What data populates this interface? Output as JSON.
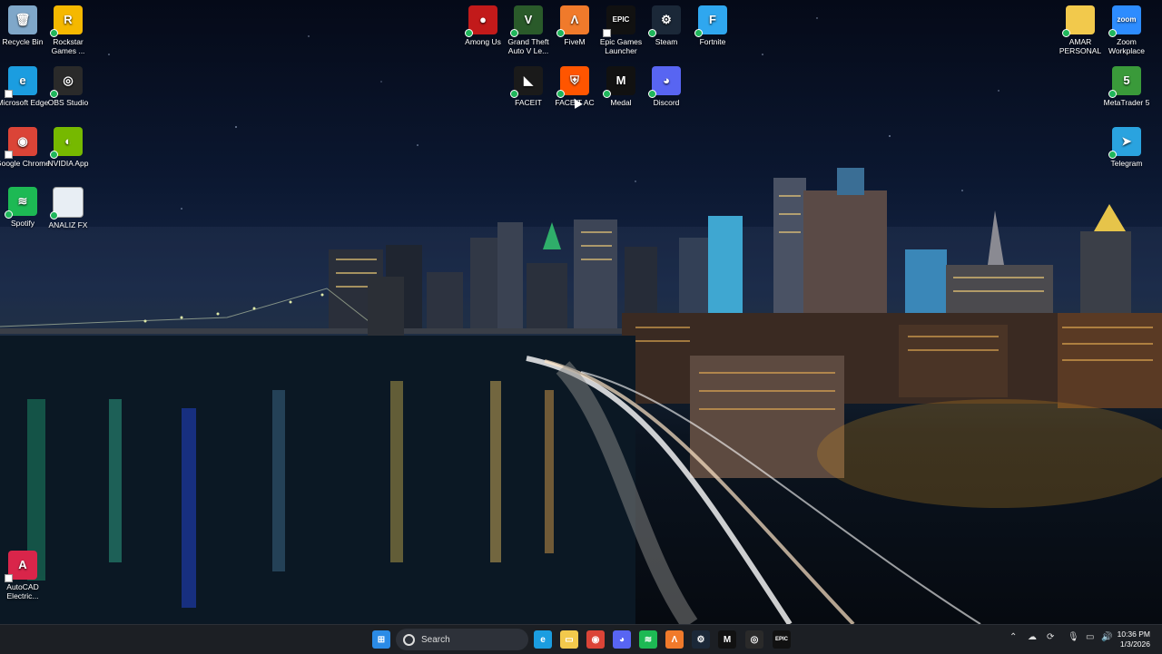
{
  "desktop_icons_left": [
    {
      "label": "Recycle Bin",
      "icon": "recycle-bin-icon",
      "color": "#7fa7c9",
      "glyph": "🗑"
    },
    {
      "label": "Rockstar Games ...",
      "icon": "rockstar-icon",
      "color": "#f5b800",
      "glyph": "R"
    },
    {
      "label": "Microsoft Edge",
      "icon": "edge-icon",
      "color": "#1b9de0",
      "glyph": "e"
    },
    {
      "label": "OBS Studio",
      "icon": "obs-icon",
      "color": "#2a2a2a",
      "glyph": "◎"
    },
    {
      "label": "Google Chrome",
      "icon": "chrome-icon",
      "color": "#db4437",
      "glyph": "◉"
    },
    {
      "label": "NVIDIA App",
      "icon": "nvidia-icon",
      "color": "#76b900",
      "glyph": "◐"
    },
    {
      "label": "Spotify",
      "icon": "spotify-icon",
      "color": "#1db954",
      "glyph": "≋"
    },
    {
      "label": "ANALIZ FX",
      "icon": "document-icon",
      "color": "#e8eef4",
      "glyph": ""
    },
    {
      "label": "AutoCAD Electric...",
      "icon": "autocad-icon",
      "color": "#d9254a",
      "glyph": "A"
    }
  ],
  "desktop_icons_top": [
    {
      "label": "Among Us",
      "icon": "among-us-icon",
      "color": "#c21a1a",
      "glyph": "●"
    },
    {
      "label": "Grand Theft Auto V Le...",
      "icon": "gta-icon",
      "color": "#2a5a2a",
      "glyph": "V"
    },
    {
      "label": "FiveM",
      "icon": "fivem-icon",
      "color": "#f07a2b",
      "glyph": "Λ"
    },
    {
      "label": "Epic Games Launcher",
      "icon": "epic-icon",
      "color": "#111111",
      "glyph": "EPIC"
    },
    {
      "label": "Steam",
      "icon": "steam-icon",
      "color": "#1b2838",
      "glyph": "⚙"
    },
    {
      "label": "Fortnite",
      "icon": "fortnite-icon",
      "color": "#2fa7ef",
      "glyph": "F"
    },
    {
      "label": "FACEIT",
      "icon": "faceit-icon",
      "color": "#1a1a1a",
      "glyph": "◣"
    },
    {
      "label": "FACEIT AC",
      "icon": "faceit-ac-icon",
      "color": "#ff5500",
      "glyph": "⛨"
    },
    {
      "label": "Medal",
      "icon": "medal-icon",
      "color": "#111111",
      "glyph": "M"
    },
    {
      "label": "Discord",
      "icon": "discord-icon",
      "color": "#5865f2",
      "glyph": "◕"
    }
  ],
  "desktop_icons_right": [
    {
      "label": "AMAR PERSONAL",
      "icon": "folder-icon",
      "color": "#f2c94c",
      "glyph": ""
    },
    {
      "label": "Zoom Workplace",
      "icon": "zoom-icon",
      "color": "#2d8cff",
      "glyph": "zoom"
    },
    {
      "label": "MetaTrader 5",
      "icon": "metatrader-icon",
      "color": "#3a9a3a",
      "glyph": "5"
    },
    {
      "label": "Telegram",
      "icon": "telegram-icon",
      "color": "#2aa3df",
      "glyph": "➤"
    }
  ],
  "taskbar": {
    "search_placeholder": "Search",
    "time": "10:36 PM",
    "date": "1/3/2026",
    "icons": [
      {
        "name": "windows-start-icon",
        "color": "#2b8be6",
        "glyph": "⊞"
      },
      {
        "name": "edge-icon",
        "color": "#1b9de0",
        "glyph": "e"
      },
      {
        "name": "file-explorer-icon",
        "color": "#f2c94c",
        "glyph": "▭"
      },
      {
        "name": "chrome-icon",
        "color": "#db4437",
        "glyph": "◉"
      },
      {
        "name": "discord-icon",
        "color": "#5865f2",
        "glyph": "◕"
      },
      {
        "name": "spotify-icon",
        "color": "#1db954",
        "glyph": "≋"
      },
      {
        "name": "fivem-icon",
        "color": "#f07a2b",
        "glyph": "Λ"
      },
      {
        "name": "steam-icon",
        "color": "#1b2838",
        "glyph": "⚙"
      },
      {
        "name": "medal-icon",
        "color": "#111111",
        "glyph": "M"
      },
      {
        "name": "obs-icon",
        "color": "#2a2a2a",
        "glyph": "◎"
      },
      {
        "name": "epic-icon",
        "color": "#111111",
        "glyph": "EPIC"
      }
    ]
  }
}
